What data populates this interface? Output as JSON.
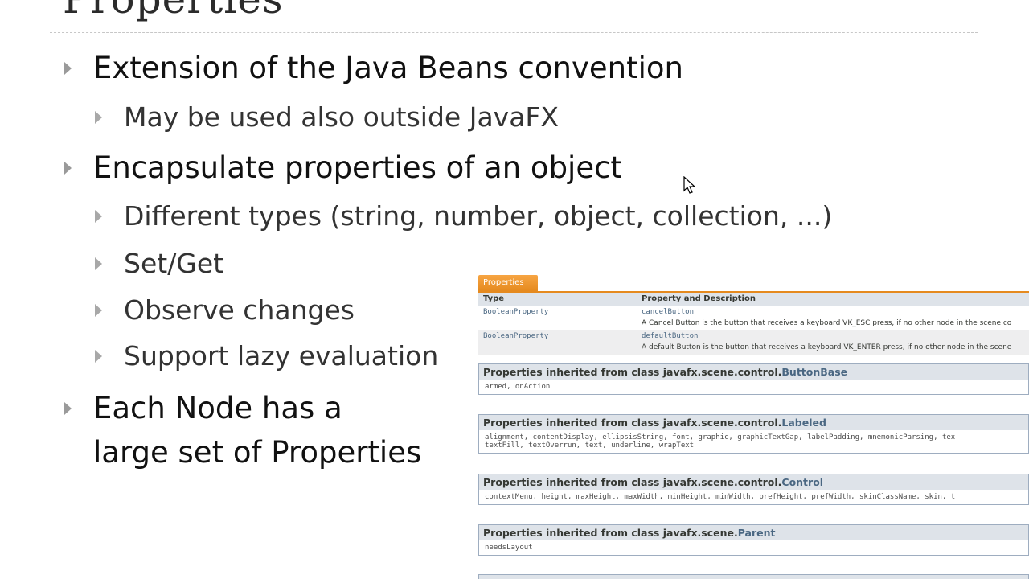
{
  "slide": {
    "title": "Properties",
    "bullets": [
      "Extension of the Java Beans convention",
      "May be used also outside JavaFX",
      "Encapsulate properties of an object",
      "Different types (string, number, object, collection, ...)",
      "Set/Get",
      "Observe changes",
      "Support lazy evaluation",
      "Each Node has a",
      "large set of Properties"
    ]
  },
  "javadoc": {
    "tab": "Properties",
    "headers": {
      "type": "Type",
      "desc": "Property and Description"
    },
    "rows": [
      {
        "type": "BooleanProperty",
        "name": "cancelButton",
        "desc": "A Cancel Button is the button that receives a keyboard VK_ESC press, if no other node in the scene co"
      },
      {
        "type": "BooleanProperty",
        "name": "defaultButton",
        "desc": "A default Button is the button that receives a keyboard VK_ENTER press, if no other node in the scene"
      }
    ],
    "sections": [
      {
        "prefix": "Properties inherited from class javafx.scene.control.",
        "cls": "ButtonBase",
        "line1": "armed, onAction",
        "line2": ""
      },
      {
        "prefix": "Properties inherited from class javafx.scene.control.",
        "cls": "Labeled",
        "line1": "alignment, contentDisplay, ellipsisString, font, graphic, graphicTextGap, labelPadding, mnemonicParsing, tex",
        "line2": "textFill, textOverrun, text, underline, wrapText"
      },
      {
        "prefix": "Properties inherited from class javafx.scene.control.",
        "cls": "Control",
        "line1": "contextMenu, height, maxHeight, maxWidth, minHeight, minWidth, prefHeight, prefWidth, skinClassName, skin, t",
        "line2": ""
      },
      {
        "prefix": "Properties inherited from class javafx.scene.",
        "cls": "Parent",
        "line1": "needsLayout",
        "line2": ""
      }
    ]
  }
}
